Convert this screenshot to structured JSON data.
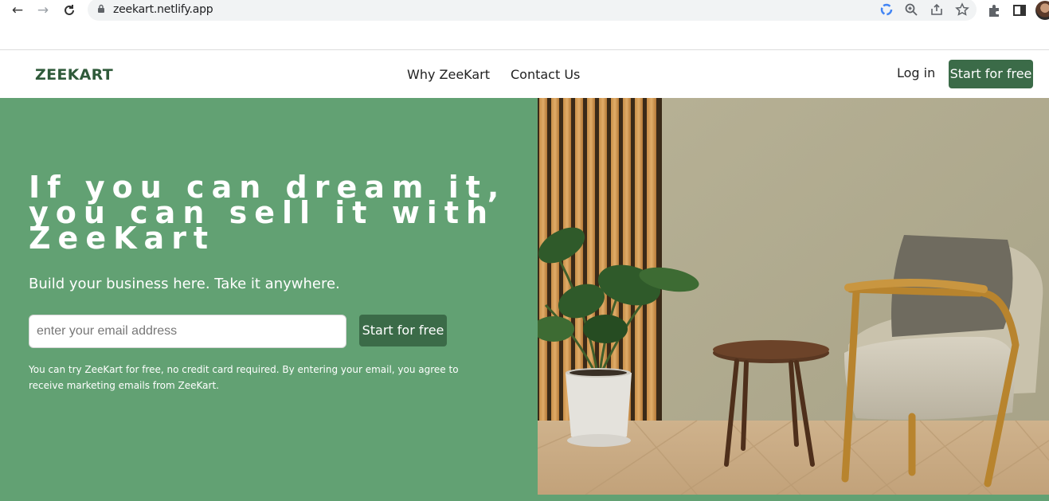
{
  "browser": {
    "url": "zeekart.netlify.app",
    "back_icon": "arrow-left-icon",
    "forward_icon": "arrow-right-icon",
    "reload_icon": "reload-icon"
  },
  "nav": {
    "logo": "ZEEKART",
    "links": [
      "Why ZeeKart",
      "Contact Us"
    ],
    "login": "Log in",
    "cta": "Start for free"
  },
  "hero": {
    "headline_lines": [
      "If you can dream it,",
      "you can sell it with",
      "ZeeKart"
    ],
    "subheading": "Build your business here. Take it anywhere.",
    "email_placeholder": "enter your email address",
    "cta": "Start for free",
    "note": "You can try ZeeKart for free, no credit card required. By entering your email, you agree to receive marketing emails from ZeeKart."
  },
  "colors": {
    "brand_green": "#3b6b48",
    "hero_green": "#62a173"
  }
}
